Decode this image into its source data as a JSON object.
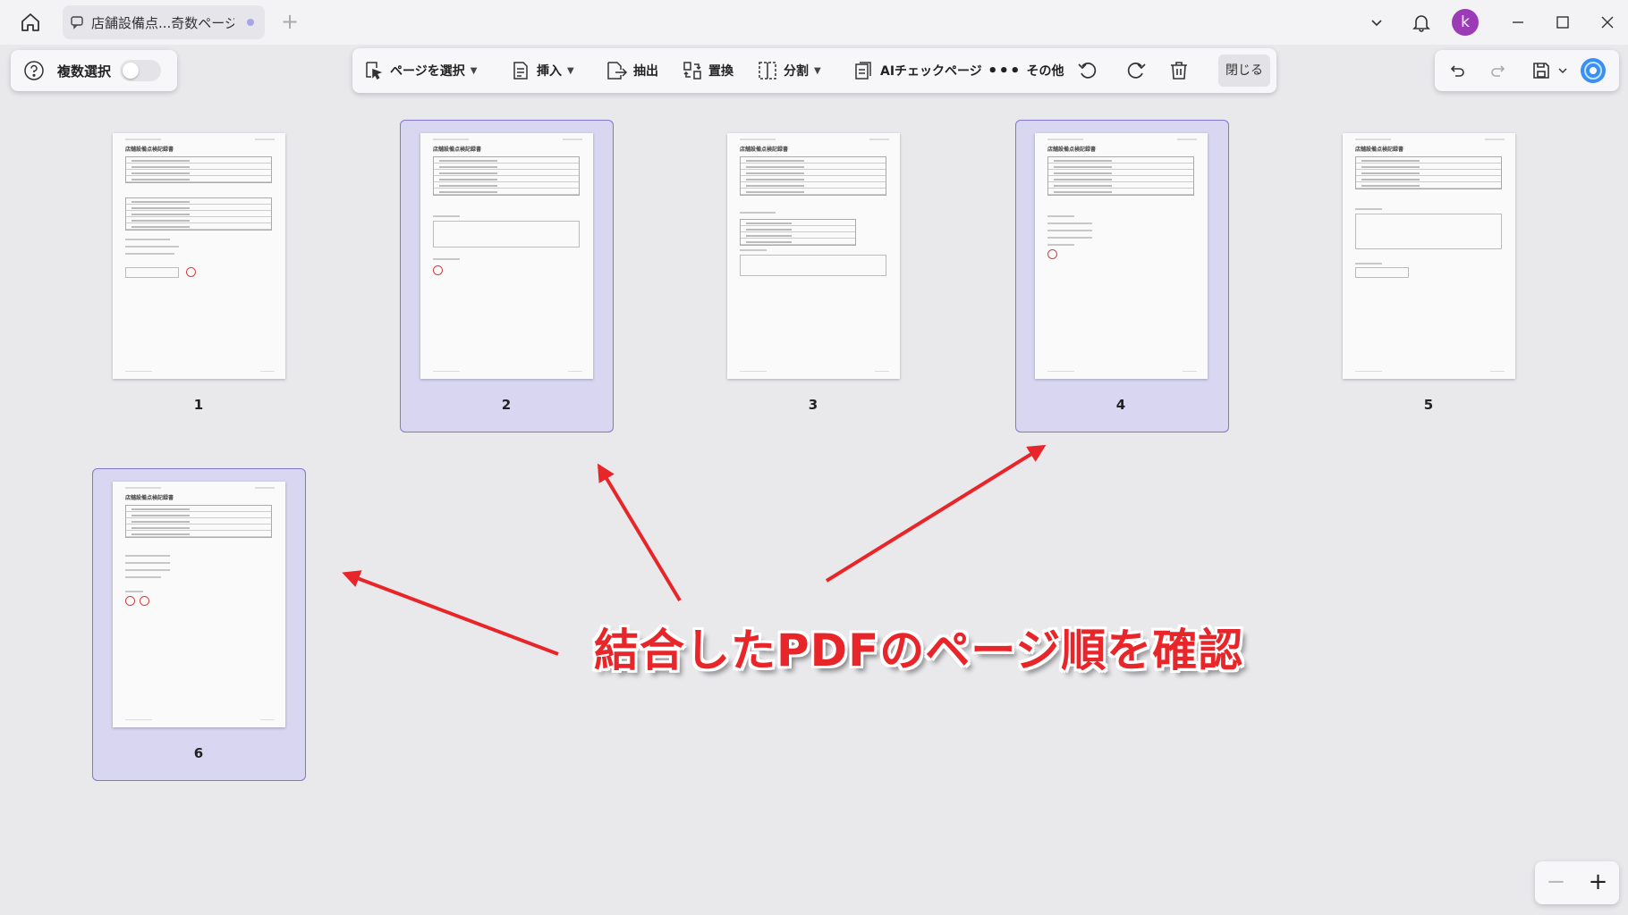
{
  "titlebar": {
    "tab_title": "店舗設備点...奇数ページ",
    "new_tab_label": "+",
    "avatar_letter": "k",
    "icons": [
      "home-icon",
      "comment-icon",
      "chevron-down-icon",
      "bell-icon",
      "minimize-icon",
      "maximize-icon",
      "close-icon"
    ]
  },
  "left_panel": {
    "multi_select_label": "複数選択",
    "multi_select_on": false
  },
  "toolbar": {
    "select_page": "ページを選択",
    "insert": "挿入",
    "extract": "抽出",
    "replace": "置換",
    "split": "分割",
    "ai_check": "AIチェックページ",
    "more": "その他",
    "close": "閉じる"
  },
  "zoom": {
    "minus": "−",
    "plus": "+"
  },
  "pages": [
    {
      "number": "1",
      "title": "店舗設備点検記録書",
      "selected": false
    },
    {
      "number": "2",
      "title": "店舗設備点検記録書",
      "selected": true
    },
    {
      "number": "3",
      "title": "店舗設備点検記録書",
      "selected": false
    },
    {
      "number": "4",
      "title": "店舗設備点検記録書",
      "selected": true
    },
    {
      "number": "5",
      "title": "店舗設備点検記録書",
      "selected": false
    },
    {
      "number": "6",
      "title": "店舗設備点検記録書",
      "selected": true
    }
  ],
  "annotation": {
    "caption": "結合したPDFのページ順を確認",
    "color": "#e8262a"
  },
  "colors": {
    "selection_fill": "#d8d6f0",
    "selection_border": "#7f76d6",
    "avatar": "#9b3bb6"
  }
}
